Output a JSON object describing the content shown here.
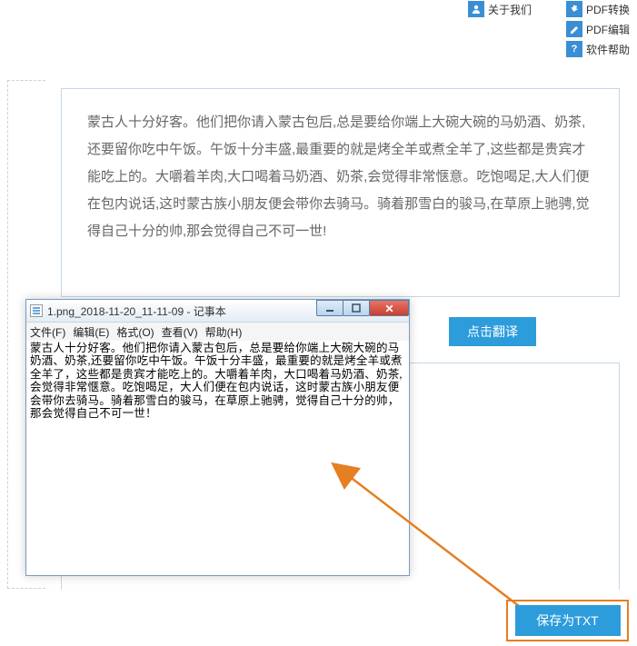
{
  "topNav": {
    "left": {
      "aboutUs": "关于我们",
      "aboutIcon": "👤"
    },
    "right": {
      "pdfConvert": "PDF转换",
      "pdfEdit": "PDF编辑",
      "swHelp": "软件帮助"
    }
  },
  "content": {
    "text": "蒙古人十分好客。他们把你请入蒙古包后,总是要给你端上大碗大碗的马奶酒、奶茶,还要留你吃中午饭。午饭十分丰盛,最重要的就是烤全羊或煮全羊了,这些都是贵宾才能吃上的。大嚼着羊肉,大口喝着马奶酒、奶茶,会觉得非常惬意。吃饱喝足,大人们便在包内说话,这时蒙古族小朋友便会带你去骑马。骑着那雪白的骏马,在草原上驰骋,觉得自己十分的帅,那会觉得自己不可一世!"
  },
  "buttons": {
    "translate": "点击翻译",
    "saveTxt": "保存为TXT"
  },
  "notepad": {
    "title": "1.png_2018-11-20_11-11-09 - 记事本",
    "menu": {
      "file": "文件(F)",
      "edit": "编辑(E)",
      "format": "格式(O)",
      "view": "查看(V)",
      "help": "帮助(H)"
    },
    "body": "蒙古人十分好客。他们把你请入蒙古包后，总是要给你端上大碗大碗的马奶酒、奶茶,还要留你吃中午饭。午饭十分丰盛，最重要的就是烤全羊或煮全羊了，这些都是贵宾才能吃上的。大嚼着羊肉，大口喝着马奶酒、奶茶,会觉得非常惬意。吃饱喝足，大人们便在包内说话，这时蒙古族小朋友便会带你去骑马。骑着那雪白的骏马，在草原上驰骋，觉得自己十分的帅，那会觉得自己不可一世！"
  }
}
